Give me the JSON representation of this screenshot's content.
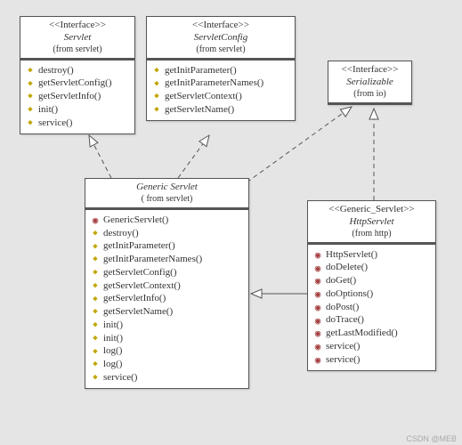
{
  "classes": {
    "servlet": {
      "stereotype": "<<Interface>>",
      "name": "Servlet",
      "package": "(from servlet)",
      "members": [
        {
          "icon": "diamond",
          "text": "destroy()"
        },
        {
          "icon": "diamond",
          "text": "getServletConfig()"
        },
        {
          "icon": "diamond",
          "text": "getServletInfo()"
        },
        {
          "icon": "diamond",
          "text": "init()"
        },
        {
          "icon": "diamond",
          "text": "service()"
        }
      ]
    },
    "servletConfig": {
      "stereotype": "<<Interface>>",
      "name": "ServletConfig",
      "package": "(from servlet)",
      "members": [
        {
          "icon": "diamond",
          "text": "getInitParameter()"
        },
        {
          "icon": "diamond",
          "text": "getInitParameterNames()"
        },
        {
          "icon": "diamond",
          "text": "getServletContext()"
        },
        {
          "icon": "diamond",
          "text": "getServletName()"
        }
      ]
    },
    "serializable": {
      "stereotype": "<<Interface>>",
      "name": "Serializable",
      "package": "(from io)"
    },
    "genericServlet": {
      "name": "Generic Servlet",
      "package": "( from servlet)",
      "members": [
        {
          "icon": "circle",
          "text": "GenericServlet()"
        },
        {
          "icon": "diamond",
          "text": "destroy()"
        },
        {
          "icon": "diamond",
          "text": "getInitParameter()"
        },
        {
          "icon": "diamond",
          "text": "getInitParameterNames()"
        },
        {
          "icon": "diamond",
          "text": "getServletConfig()"
        },
        {
          "icon": "diamond",
          "text": "getServletContext()"
        },
        {
          "icon": "diamond",
          "text": "getServletInfo()"
        },
        {
          "icon": "diamond",
          "text": "getServletName()"
        },
        {
          "icon": "diamond",
          "text": "init()"
        },
        {
          "icon": "diamond",
          "text": "init()"
        },
        {
          "icon": "diamond",
          "text": "log()"
        },
        {
          "icon": "diamond",
          "text": "log()"
        },
        {
          "icon": "diamond",
          "text": "service()"
        }
      ]
    },
    "httpServlet": {
      "stereotype": "<<Generic_Servlet>>",
      "name": "HttpServlet",
      "package": "(from http)",
      "members": [
        {
          "icon": "circle",
          "text": "HttpServlet()"
        },
        {
          "icon": "circle",
          "text": "doDelete()"
        },
        {
          "icon": "circle",
          "text": "doGet()"
        },
        {
          "icon": "circle",
          "text": "doOptions()"
        },
        {
          "icon": "circle",
          "text": "doPost()"
        },
        {
          "icon": "circle",
          "text": "doTrace()"
        },
        {
          "icon": "circle",
          "text": "getLastModified()"
        },
        {
          "icon": "circle",
          "text": "service()"
        },
        {
          "icon": "circle",
          "text": "service()"
        }
      ]
    }
  },
  "watermark": "CSDN @MEB"
}
